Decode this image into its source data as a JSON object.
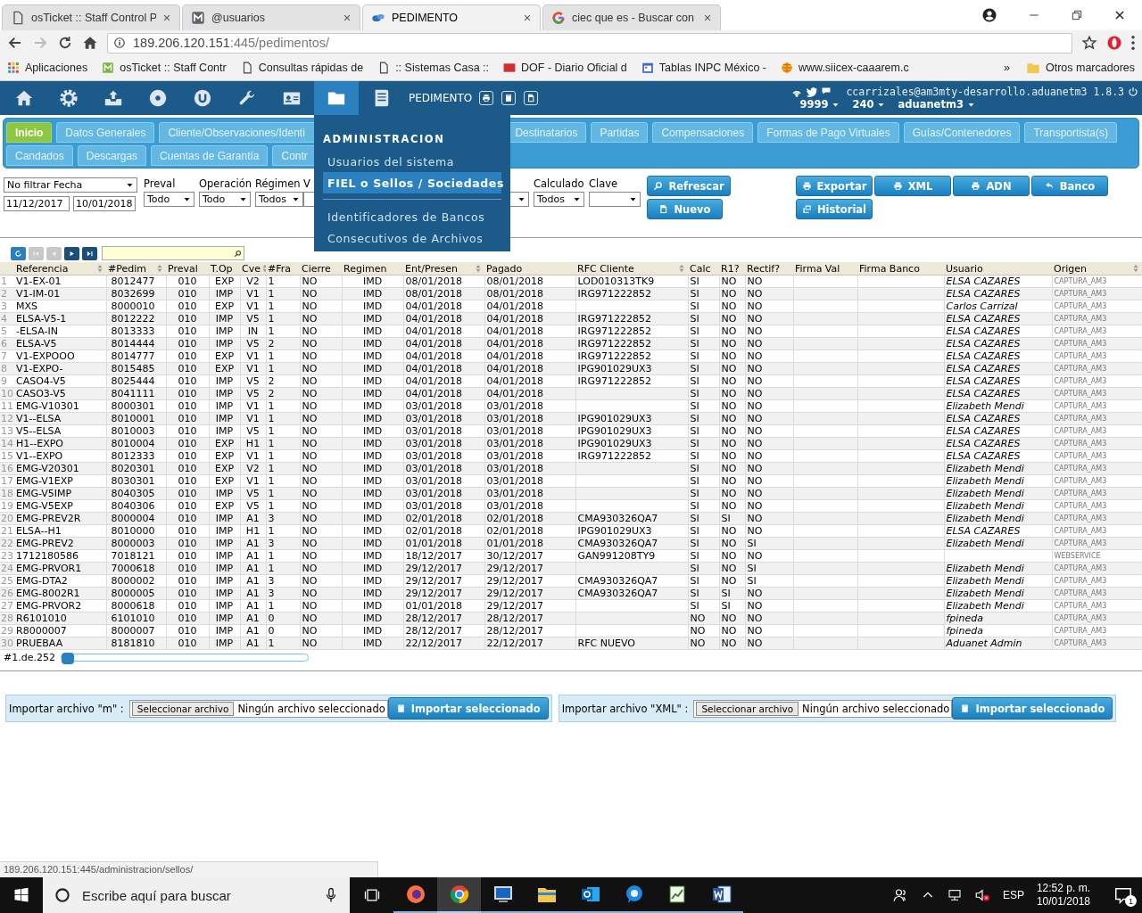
{
  "browser": {
    "tabs": [
      {
        "title": "osTicket :: Staff Control P",
        "kind": "page",
        "selected": false
      },
      {
        "title": "@usuarios",
        "kind": "m-logo",
        "selected": false
      },
      {
        "title": "PEDIMENTO",
        "kind": "bird",
        "selected": true
      },
      {
        "title": "ciec que es - Buscar con",
        "kind": "g-logo",
        "selected": false
      }
    ],
    "url_host": "189.206.120.151",
    "url_rest": ":445/pedimentos/",
    "bookmarks": [
      {
        "label": "Aplicaciones",
        "kind": "apps"
      },
      {
        "label": "osTicket :: Staff Contr",
        "kind": "m-green"
      },
      {
        "label": "Consultas rápidas de",
        "kind": "page"
      },
      {
        "label": ":: Sistemas Casa ::",
        "kind": "page"
      },
      {
        "label": "DOF - Diario Oficial d",
        "kind": "dof"
      },
      {
        "label": "Tablas INPC México -",
        "kind": "calendar"
      },
      {
        "label": "www.siicex-caaarem.c",
        "kind": "globe"
      }
    ],
    "more": "»",
    "other_bookmarks": "Otros marcadores"
  },
  "header": {
    "nav": [
      {
        "kind": "home",
        "selected": false
      },
      {
        "kind": "gear",
        "selected": false
      },
      {
        "kind": "tray",
        "selected": false
      },
      {
        "kind": "disc",
        "selected": false
      },
      {
        "kind": "u-circle",
        "selected": false
      },
      {
        "kind": "wrench",
        "selected": false
      },
      {
        "kind": "id-card",
        "selected": false
      },
      {
        "kind": "folder",
        "selected": true
      },
      {
        "kind": "notebook",
        "selected": false
      }
    ],
    "module": "PEDIMENTO",
    "tools": [
      {
        "kind": "printer"
      },
      {
        "kind": "book"
      },
      {
        "kind": "doc"
      }
    ],
    "user": "ccarrizales@am3mty-desarrollo.aduanetm3 1.8.3",
    "selectors": [
      "9999",
      "240",
      "aduanetm3"
    ]
  },
  "tabs": {
    "lines": [
      {
        "items": [
          {
            "label": "Inicio",
            "selected": true
          },
          {
            "label": "Datos Generales",
            "selected": false
          },
          {
            "label": "Cliente/Observaciones/Identi",
            "selected": false
          },
          {
            "label": "Destinatarios",
            "selected": false
          },
          {
            "label": "Partidas",
            "selected": false
          },
          {
            "label": "Compensaciones",
            "selected": false
          },
          {
            "label": "Formas de Pago Virtuales",
            "selected": false
          },
          {
            "label": "Guías/Contenedores",
            "selected": false
          },
          {
            "label": "Transportista(s)",
            "selected": false
          }
        ]
      },
      {
        "items": [
          {
            "label": "Candados",
            "selected": false
          },
          {
            "label": "Descargas",
            "selected": false
          },
          {
            "label": "Cuentas de Garantía",
            "selected": false
          },
          {
            "label": "Contr",
            "selected": false
          }
        ]
      }
    ]
  },
  "menu": {
    "heading": "ADMINISTRACION",
    "items": [
      {
        "kind": "item",
        "label": "Usuarios del sistema",
        "selected": false
      },
      {
        "kind": "item",
        "label": "FIEL o Sellos / Sociedades",
        "selected": true
      },
      {
        "kind": "separator"
      },
      {
        "kind": "item",
        "label": "Identificadores de Bancos",
        "selected": false
      },
      {
        "kind": "item",
        "label": "Consecutivos de Archivos",
        "selected": false
      }
    ]
  },
  "filters": {
    "date_filter": "No filtrar Fecha",
    "date_from": "11/12/2017",
    "date_to": "10/01/2018",
    "selects": [
      {
        "label": "Preval",
        "value": "Todo"
      },
      {
        "label": "Operación",
        "value": "Todo"
      },
      {
        "label": "Régimen",
        "value": "Todos"
      },
      {
        "label": "V"
      },
      {
        "label": "Calculado",
        "value": "Todos"
      },
      {
        "label": "Clave"
      }
    ]
  },
  "actions": [
    {
      "label": "Refrescar",
      "kind": "search"
    },
    {
      "label": "Nuevo",
      "kind": "doc"
    }
  ],
  "export_actions": [
    {
      "label": "Exportar",
      "kind": "printer"
    },
    {
      "label": "XML",
      "kind": "printer"
    },
    {
      "label": "ADN",
      "kind": "printer"
    },
    {
      "label": "Banco",
      "kind": "undo"
    },
    {
      "label": "Historial",
      "kind": "windows"
    }
  ],
  "table_toolbar": {
    "buttons": [
      {
        "kind": "refresh",
        "disabled": false
      },
      {
        "kind": "first",
        "disabled": true
      },
      {
        "kind": "prev",
        "disabled": true
      },
      {
        "kind": "next",
        "disabled": false
      },
      {
        "kind": "last",
        "disabled": false
      }
    ]
  },
  "table": {
    "columns": [
      {
        "label": "Referencia",
        "sortable": true
      },
      {
        "label": "#Pedim",
        "sortable": true
      },
      {
        "label": "Preval",
        "sortable": false
      },
      {
        "label": "T.Op",
        "sortable": false
      },
      {
        "label": "Cve",
        "sortable": true
      },
      {
        "label": "#Fra",
        "sortable": false
      },
      {
        "label": "Cierre",
        "sortable": false
      },
      {
        "label": "Regimen",
        "sortable": false
      },
      {
        "label": "Ent/Presen",
        "sortable": true
      },
      {
        "label": "Pagado",
        "sortable": false
      },
      {
        "label": "RFC Cliente",
        "sortable": true
      },
      {
        "label": "Calc",
        "sortable": false
      },
      {
        "label": "R1?",
        "sortable": false
      },
      {
        "label": "Rectif?",
        "sortable": false
      },
      {
        "label": "Firma Val",
        "sortable": false
      },
      {
        "label": "Firma Banco",
        "sortable": false
      },
      {
        "label": "Usuario",
        "sortable": false
      },
      {
        "label": "Origen",
        "sortable": true
      }
    ],
    "rows": [
      {
        "number": "1",
        "cells": [
          "V1-EX-01",
          "8012477",
          "010",
          "EXP",
          "V2",
          "1",
          "NO",
          "IMD",
          "08/01/2018",
          "08/01/2018",
          "LOD010313TK9",
          "SI",
          "NO",
          "NO",
          null,
          null,
          "ELSA CAZARES",
          "CAPTURA_AM3"
        ]
      },
      {
        "number": "2",
        "cells": [
          "V1-IM-01",
          "8032699",
          "010",
          "IMP",
          "V1",
          "1",
          "NO",
          "IMD",
          "08/01/2018",
          "08/01/2018",
          "IRG971222852",
          "SI",
          "NO",
          "NO",
          null,
          null,
          "ELSA CAZARES",
          "CAPTURA_AM3"
        ]
      },
      {
        "number": "3",
        "cells": [
          "MXS",
          "8000010",
          "010",
          "EXP",
          "V1",
          "1",
          "NO",
          "IMD",
          "04/01/2018",
          "04/01/2018",
          null,
          "SI",
          "NO",
          "NO",
          null,
          null,
          "Carlos Carrizal",
          "CAPTURA_AM3"
        ]
      },
      {
        "number": "4",
        "cells": [
          "ELSA-V5-1",
          "8012222",
          "010",
          "IMP",
          "V5",
          "1",
          "NO",
          "IMD",
          "04/01/2018",
          "04/01/2018",
          "IRG971222852",
          "SI",
          "NO",
          "NO",
          null,
          null,
          "ELSA CAZARES",
          "CAPTURA_AM3"
        ]
      },
      {
        "number": "5",
        "cells": [
          "-ELSA-IN",
          "8013333",
          "010",
          "IMP",
          "IN",
          "1",
          "NO",
          "IMD",
          "04/01/2018",
          "04/01/2018",
          "IRG971222852",
          "SI",
          "NO",
          "NO",
          null,
          null,
          "ELSA CAZARES",
          "CAPTURA_AM3"
        ]
      },
      {
        "number": "6",
        "cells": [
          "ELSA-V5",
          "8014444",
          "010",
          "IMP",
          "V5",
          "2",
          "NO",
          "IMD",
          "04/01/2018",
          "04/01/2018",
          "IRG971222852",
          "SI",
          "NO",
          "NO",
          null,
          null,
          "ELSA CAZARES",
          "CAPTURA_AM3"
        ]
      },
      {
        "number": "7",
        "cells": [
          "V1-EXPOOO",
          "8014777",
          "010",
          "EXP",
          "V1",
          "1",
          "NO",
          "IMD",
          "04/01/2018",
          "04/01/2018",
          "IRG971222852",
          "SI",
          "NO",
          "NO",
          null,
          null,
          "ELSA CAZARES",
          "CAPTURA_AM3"
        ]
      },
      {
        "number": "8",
        "cells": [
          "V1-EXPO-",
          "8015485",
          "010",
          "EXP",
          "V1",
          "1",
          "NO",
          "IMD",
          "04/01/2018",
          "04/01/2018",
          "IPG901029UX3",
          "SI",
          "NO",
          "NO",
          null,
          null,
          "ELSA CAZARES",
          "CAPTURA_AM3"
        ]
      },
      {
        "number": "9",
        "cells": [
          "CASO4-V5",
          "8025444",
          "010",
          "IMP",
          "V5",
          "2",
          "NO",
          "IMD",
          "04/01/2018",
          "04/01/2018",
          "IRG971222852",
          "SI",
          "NO",
          "NO",
          null,
          null,
          "ELSA CAZARES",
          "CAPTURA_AM3"
        ]
      },
      {
        "number": "10",
        "cells": [
          "CASO3-V5",
          "8041111",
          "010",
          "IMP",
          "V5",
          "2",
          "NO",
          "IMD",
          "04/01/2018",
          "04/01/2018",
          null,
          "SI",
          "NO",
          "NO",
          null,
          null,
          "ELSA CAZARES",
          "CAPTURA_AM3"
        ]
      },
      {
        "number": "11",
        "cells": [
          "EMG-V10301",
          "8000301",
          "010",
          "IMP",
          "V1",
          "1",
          "NO",
          "IMD",
          "03/01/2018",
          "03/01/2018",
          null,
          "SI",
          "NO",
          "NO",
          null,
          null,
          "Elizabeth Mendi",
          "CAPTURA_AM3"
        ]
      },
      {
        "number": "12",
        "cells": [
          "V1--ELSA",
          "8010001",
          "010",
          "IMP",
          "V1",
          "1",
          "NO",
          "IMD",
          "03/01/2018",
          "03/01/2018",
          "IPG901029UX3",
          "SI",
          "NO",
          "NO",
          null,
          null,
          "ELSA CAZARES",
          "CAPTURA_AM3"
        ]
      },
      {
        "number": "13",
        "cells": [
          "V5--ELSA",
          "8010003",
          "010",
          "IMP",
          "V5",
          "1",
          "NO",
          "IMD",
          "03/01/2018",
          "03/01/2018",
          "IPG901029UX3",
          "SI",
          "NO",
          "NO",
          null,
          null,
          "ELSA CAZARES",
          "CAPTURA_AM3"
        ]
      },
      {
        "number": "14",
        "cells": [
          "H1--EXPO",
          "8010004",
          "010",
          "EXP",
          "H1",
          "1",
          "NO",
          "IMD",
          "03/01/2018",
          "03/01/2018",
          "IPG901029UX3",
          "SI",
          "NO",
          "NO",
          null,
          null,
          "ELSA CAZARES",
          "CAPTURA_AM3"
        ]
      },
      {
        "number": "15",
        "cells": [
          "V1--EXPO",
          "8012333",
          "010",
          "EXP",
          "V1",
          "1",
          "NO",
          "IMD",
          "03/01/2018",
          "03/01/2018",
          "IRG971222852",
          "SI",
          "NO",
          "NO",
          null,
          null,
          "ELSA CAZARES",
          "CAPTURA_AM3"
        ]
      },
      {
        "number": "16",
        "cells": [
          "EMG-V20301",
          "8020301",
          "010",
          "EXP",
          "V2",
          "1",
          "NO",
          "IMD",
          "03/01/2018",
          "03/01/2018",
          null,
          "SI",
          "NO",
          "NO",
          null,
          null,
          "Elizabeth Mendi",
          "CAPTURA_AM3"
        ]
      },
      {
        "number": "17",
        "cells": [
          "EMG-V1EXP",
          "8030301",
          "010",
          "EXP",
          "V1",
          "1",
          "NO",
          "IMD",
          "03/01/2018",
          "03/01/2018",
          null,
          "SI",
          "NO",
          "NO",
          null,
          null,
          "Elizabeth Mendi",
          "CAPTURA_AM3"
        ]
      },
      {
        "number": "18",
        "cells": [
          "EMG-V5IMP",
          "8040305",
          "010",
          "IMP",
          "V5",
          "1",
          "NO",
          "IMD",
          "03/01/2018",
          "03/01/2018",
          null,
          "SI",
          "NO",
          "NO",
          null,
          null,
          "Elizabeth Mendi",
          "CAPTURA_AM3"
        ]
      },
      {
        "number": "19",
        "cells": [
          "EMG-V5EXP",
          "8040306",
          "010",
          "EXP",
          "V5",
          "1",
          "NO",
          "IMD",
          "03/01/2018",
          "03/01/2018",
          null,
          "SI",
          "NO",
          "NO",
          null,
          null,
          "Elizabeth Mendi",
          "CAPTURA_AM3"
        ]
      },
      {
        "number": "20",
        "cells": [
          "EMG-PREV2R",
          "8000004",
          "010",
          "IMP",
          "A1",
          "3",
          "NO",
          "IMD",
          "02/01/2018",
          "02/01/2018",
          "CMA930326QA7",
          "SI",
          "SI",
          "NO",
          null,
          null,
          "Elizabeth Mendi",
          "CAPTURA_AM3"
        ]
      },
      {
        "number": "21",
        "cells": [
          "ELSA--H1",
          "8010000",
          "010",
          "IMP",
          "H1",
          "1",
          "NO",
          "IMD",
          "02/01/2018",
          "02/01/2018",
          "IPG901029UX3",
          "SI",
          "NO",
          "NO",
          null,
          null,
          "ELSA CAZARES",
          "CAPTURA_AM3"
        ]
      },
      {
        "number": "22",
        "cells": [
          "EMG-PREV2",
          "8000003",
          "010",
          "IMP",
          "A1",
          "3",
          "NO",
          "IMD",
          "01/01/2018",
          "01/01/2018",
          "CMA930326QA7",
          "SI",
          "NO",
          "SI",
          null,
          null,
          "Elizabeth Mendi",
          "CAPTURA_AM3"
        ]
      },
      {
        "number": "23",
        "cells": [
          "1712180586",
          "7018121",
          "010",
          "IMP",
          "A1",
          "1",
          "NO",
          "IMD",
          "18/12/2017",
          "30/12/2017",
          "GAN991208TY9",
          "SI",
          "NO",
          "NO",
          null,
          null,
          null,
          "WEBSERVICE"
        ]
      },
      {
        "number": "24",
        "cells": [
          "EMG-PRVOR1",
          "7000618",
          "010",
          "IMP",
          "A1",
          "1",
          "NO",
          "IMD",
          "29/12/2017",
          "29/12/2017",
          null,
          "SI",
          "NO",
          "SI",
          null,
          null,
          "Elizabeth Mendi",
          "CAPTURA_AM3"
        ]
      },
      {
        "number": "25",
        "cells": [
          "EMG-DTA2",
          "8000002",
          "010",
          "IMP",
          "A1",
          "3",
          "NO",
          "IMD",
          "29/12/2017",
          "29/12/2017",
          "CMA930326QA7",
          "SI",
          "NO",
          "SI",
          null,
          null,
          "Elizabeth Mendi",
          "CAPTURA_AM3"
        ]
      },
      {
        "number": "26",
        "cells": [
          "EMG-8002R1",
          "8000005",
          "010",
          "IMP",
          "A1",
          "3",
          "NO",
          "IMD",
          "29/12/2017",
          "29/12/2017",
          "CMA930326QA7",
          "SI",
          "SI",
          "NO",
          null,
          null,
          "Elizabeth Mendi",
          "CAPTURA_AM3"
        ]
      },
      {
        "number": "27",
        "cells": [
          "EMG-PRVOR2",
          "8000618",
          "010",
          "IMP",
          "A1",
          "1",
          "NO",
          "IMD",
          "01/01/2018",
          "29/12/2017",
          null,
          "SI",
          "SI",
          "NO",
          null,
          null,
          "Elizabeth Mendi",
          "CAPTURA_AM3"
        ]
      },
      {
        "number": "28",
        "cells": [
          "R6101010",
          "6101010",
          "010",
          "IMP",
          "A1",
          "0",
          "NO",
          "IMD",
          "28/12/2017",
          "28/12/2017",
          null,
          "NO",
          "NO",
          "NO",
          null,
          null,
          "fpineda",
          "CAPTURA_AM3"
        ]
      },
      {
        "number": "29",
        "cells": [
          "R8000007",
          "8000007",
          "010",
          "IMP",
          "A1",
          "0",
          "NO",
          "IMD",
          "28/12/2017",
          "28/12/2017",
          null,
          "NO",
          "NO",
          "NO",
          null,
          null,
          "fpineda",
          "CAPTURA_AM3"
        ]
      },
      {
        "number": "30",
        "cells": [
          "PRUEBAA",
          "8181810",
          "010",
          "IMP",
          "A1",
          "1",
          "NO",
          "IMD",
          "22/12/2017",
          "22/12/2017",
          "RFC NUEVO",
          "NO",
          "NO",
          "NO",
          null,
          null,
          "Aduanet Admin",
          "CAPTURA_AM3"
        ]
      }
    ]
  },
  "pager": {
    "label": "#1.de.252",
    "level": 0
  },
  "imports": [
    {
      "label": "Importar archivo \"m\" :",
      "choose": "Seleccionar archivo",
      "file": "Ningún archivo seleccionado",
      "submit": "Importar seleccionado"
    },
    {
      "label": "Importar archivo \"XML\" :",
      "choose": "Seleccionar archivo",
      "file": "Ningún archivo seleccionado",
      "submit": "Importar seleccionado"
    }
  ],
  "status_url": "189.206.120.151:445/administracion/sellos/",
  "taskbar": {
    "placeholder": "Escribe aquí para buscar",
    "apps": [
      {
        "kind": "firefox",
        "selected": false
      },
      {
        "kind": "chrome",
        "selected": true
      },
      {
        "kind": "terminal",
        "selected": false
      },
      {
        "kind": "explorer",
        "selected": false
      },
      {
        "kind": "outlook",
        "selected": false
      },
      {
        "kind": "chat",
        "selected": false
      },
      {
        "kind": "chart",
        "selected": false
      },
      {
        "kind": "word",
        "selected": false
      }
    ],
    "language": "ESP",
    "time": "12:52 p. m.",
    "date": "10/01/2018",
    "notifications": "1"
  }
}
